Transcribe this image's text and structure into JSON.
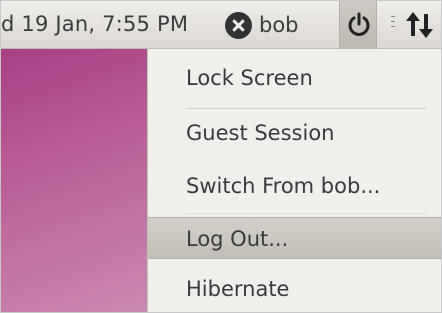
{
  "panel": {
    "clock": "d 19 Jan,  7:55 PM",
    "user_name": "bob",
    "icons": {
      "user_status": "busy-status-icon",
      "power": "power-icon",
      "network": "network-arrows-icon"
    }
  },
  "menu": {
    "items": [
      {
        "label": "Lock Screen"
      },
      {
        "label": "Guest Session"
      },
      {
        "label": "Switch From bob..."
      },
      {
        "label": "Log Out..."
      },
      {
        "label": "Hibernate"
      }
    ],
    "active_index": 3
  },
  "colors": {
    "panel_bg": "#e6e3de",
    "menu_bg": "#f1efec",
    "desktop_wallpaper": "#b0508c",
    "highlight": "#c9c5bf"
  }
}
